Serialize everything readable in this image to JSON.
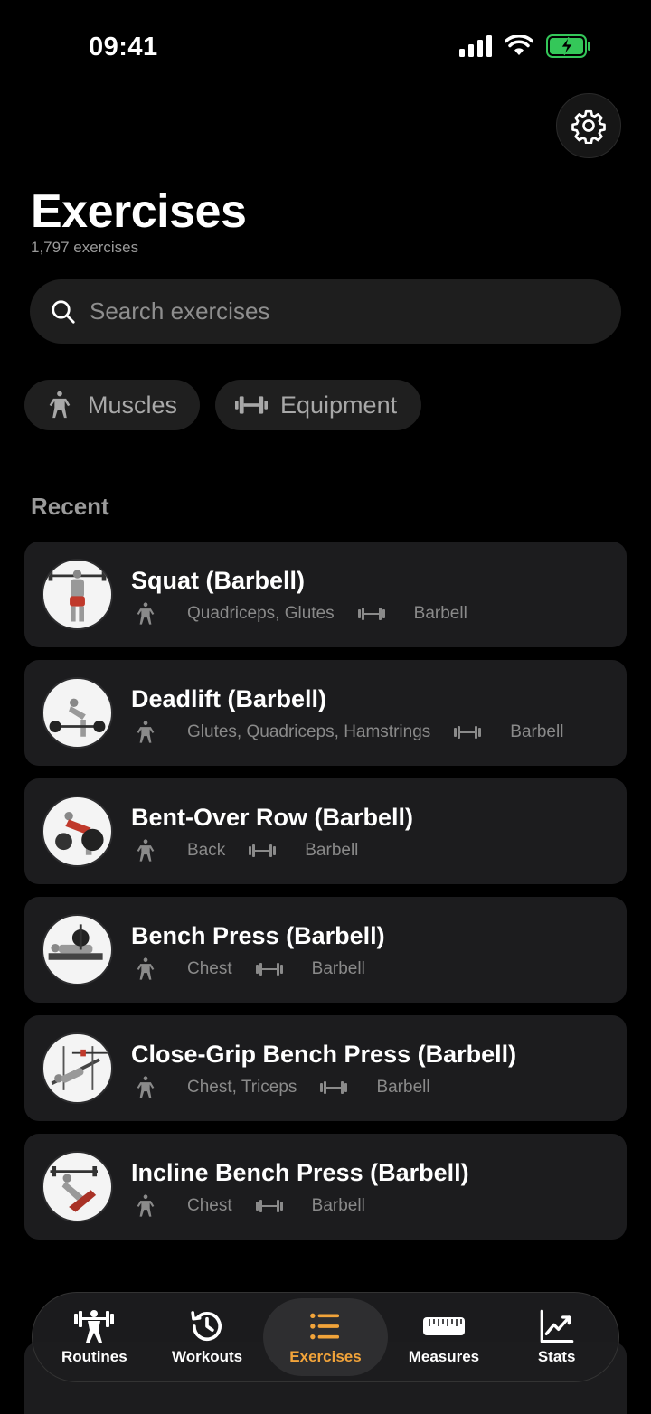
{
  "status_bar": {
    "time": "09:41"
  },
  "header": {
    "title": "Exercises",
    "subtitle": "1,797 exercises",
    "settings_icon": "gear-icon"
  },
  "search": {
    "placeholder": "Search exercises",
    "value": ""
  },
  "filters": [
    {
      "label": "Muscles",
      "icon": "muscles-icon"
    },
    {
      "label": "Equipment",
      "icon": "dumbbell-icon"
    }
  ],
  "recent": {
    "title": "Recent",
    "items": [
      {
        "name": "Squat (Barbell)",
        "muscles": "Quadriceps, Glutes",
        "equipment": "Barbell"
      },
      {
        "name": "Deadlift (Barbell)",
        "muscles": "Glutes, Quadriceps, Hamstrings",
        "equipment": "Barbell"
      },
      {
        "name": "Bent-Over Row (Barbell)",
        "muscles": "Back",
        "equipment": "Barbell"
      },
      {
        "name": "Bench Press (Barbell)",
        "muscles": "Chest",
        "equipment": "Barbell"
      },
      {
        "name": "Close-Grip Bench Press (Barbell)",
        "muscles": "Chest, Triceps",
        "equipment": "Barbell"
      },
      {
        "name": "Incline Bench Press (Barbell)",
        "muscles": "Chest",
        "equipment": "Barbell"
      }
    ]
  },
  "tabbar": {
    "tabs": [
      {
        "label": "Routines",
        "icon": "routines-icon"
      },
      {
        "label": "Workouts",
        "icon": "history-icon"
      },
      {
        "label": "Exercises",
        "icon": "list-icon",
        "active": true
      },
      {
        "label": "Measures",
        "icon": "ruler-icon"
      },
      {
        "label": "Stats",
        "icon": "chart-icon"
      }
    ]
  },
  "colors": {
    "accent": "#f2a43a",
    "background": "#000000",
    "card": "#1c1c1e"
  }
}
